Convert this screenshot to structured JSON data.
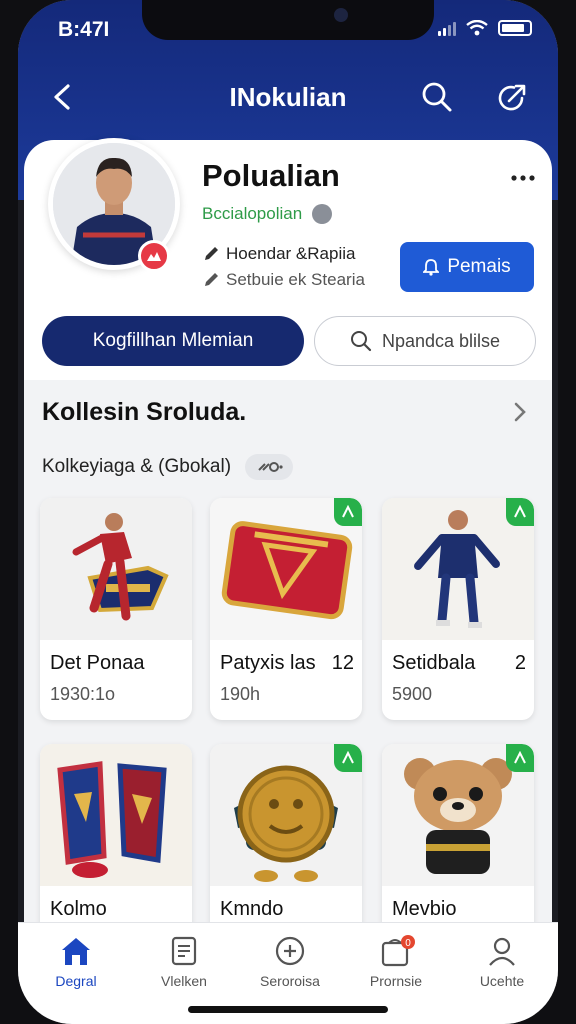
{
  "status_bar": {
    "time": "B:47I"
  },
  "nav": {
    "title": "INokulian"
  },
  "profile": {
    "name": "Polualian",
    "subtitle": "Bccialopolian",
    "meta_line1": "Hoendar &Rapiia",
    "meta_line2": "Setbuie ek Stearia",
    "follow_label": "Pemais"
  },
  "actions": {
    "primary_label": "Kogfillhan Mlemian",
    "secondary_label": "Npandca blilse"
  },
  "collection": {
    "title": "Kollesin Sroluda.",
    "filter_label": "Kolkeyiaga & (Gbokal)",
    "chip_label": " "
  },
  "items": [
    {
      "name": "Det Ponaa",
      "qty": "",
      "price": "1930:1o",
      "tag": false
    },
    {
      "name": "Patyxis las",
      "qty": "12",
      "price": "190h",
      "tag": true
    },
    {
      "name": "Setidbala",
      "qty": "2",
      "price": "5900",
      "tag": true
    },
    {
      "name": "Kolmo",
      "qty": "",
      "price": "",
      "tag": false
    },
    {
      "name": "Kmndo",
      "qty": "",
      "price": "",
      "tag": true
    },
    {
      "name": "Mevbio",
      "qty": "",
      "price": "",
      "tag": true
    }
  ],
  "tabs": [
    {
      "label": "Degral",
      "icon": "home-icon",
      "active": true
    },
    {
      "label": "Vlelken",
      "icon": "document-icon",
      "active": false
    },
    {
      "label": "Seroroisa",
      "icon": "plus-circle-icon",
      "active": false
    },
    {
      "label": "Prornsie",
      "icon": "bag-icon",
      "active": false,
      "badge": "0"
    },
    {
      "label": "Ucehte",
      "icon": "user-icon",
      "active": false
    }
  ],
  "colors": {
    "header": "#14297a",
    "primary_button": "#16296f",
    "follow_button": "#1f5bd6",
    "accent_green": "#27b04a",
    "active_tab": "#1b46c0"
  }
}
